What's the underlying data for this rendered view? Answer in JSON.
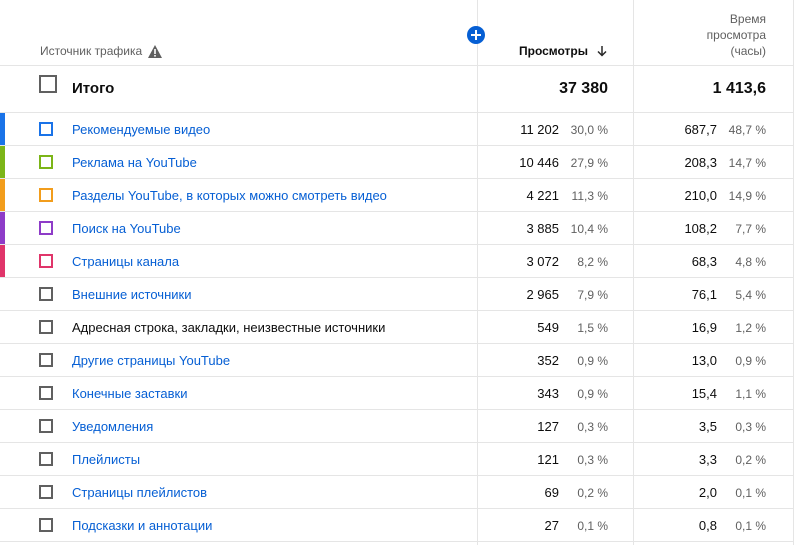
{
  "header": {
    "source_label": "Источник трафика",
    "views_label": "Просмотры",
    "watch_time_label_lines": [
      "Время",
      "просмотра",
      "(часы)"
    ]
  },
  "total": {
    "label": "Итого",
    "views": "37 380",
    "watch_time": "1 413,6"
  },
  "rows": [
    {
      "label": "Рекомендуемые видео",
      "views": "11 202",
      "views_pct": "30,0 %",
      "watch": "687,7",
      "watch_pct": "48,7 %",
      "color": "#1a73e8",
      "link": true
    },
    {
      "label": "Реклама на YouTube",
      "views": "10 446",
      "views_pct": "27,9 %",
      "watch": "208,3",
      "watch_pct": "14,7 %",
      "color": "#7cb518",
      "link": true
    },
    {
      "label": "Разделы YouTube, в которых можно смотреть видео",
      "views": "4 221",
      "views_pct": "11,3 %",
      "watch": "210,0",
      "watch_pct": "14,9 %",
      "color": "#f29d1c",
      "link": true
    },
    {
      "label": "Поиск на YouTube",
      "views": "3 885",
      "views_pct": "10,4 %",
      "watch": "108,2",
      "watch_pct": "7,7 %",
      "color": "#8e3cc8",
      "link": true
    },
    {
      "label": "Страницы канала",
      "views": "3 072",
      "views_pct": "8,2 %",
      "watch": "68,3",
      "watch_pct": "4,8 %",
      "color": "#e0356a",
      "link": true
    },
    {
      "label": "Внешние источники",
      "views": "2 965",
      "views_pct": "7,9 %",
      "watch": "76,1",
      "watch_pct": "5,4 %",
      "color": "",
      "link": true
    },
    {
      "label": "Адресная строка, закладки, неизвестные источники",
      "views": "549",
      "views_pct": "1,5 %",
      "watch": "16,9",
      "watch_pct": "1,2 %",
      "color": "",
      "link": false
    },
    {
      "label": "Другие страницы YouTube",
      "views": "352",
      "views_pct": "0,9 %",
      "watch": "13,0",
      "watch_pct": "0,9 %",
      "color": "",
      "link": true
    },
    {
      "label": "Конечные заставки",
      "views": "343",
      "views_pct": "0,9 %",
      "watch": "15,4",
      "watch_pct": "1,1 %",
      "color": "",
      "link": true
    },
    {
      "label": "Уведомления",
      "views": "127",
      "views_pct": "0,3 %",
      "watch": "3,5",
      "watch_pct": "0,3 %",
      "color": "",
      "link": true
    },
    {
      "label": "Плейлисты",
      "views": "121",
      "views_pct": "0,3 %",
      "watch": "3,3",
      "watch_pct": "0,2 %",
      "color": "",
      "link": true
    },
    {
      "label": "Страницы плейлистов",
      "views": "69",
      "views_pct": "0,2 %",
      "watch": "2,0",
      "watch_pct": "0,1 %",
      "color": "",
      "link": true
    },
    {
      "label": "Подсказки и аннотации",
      "views": "27",
      "views_pct": "0,1 %",
      "watch": "0,8",
      "watch_pct": "0,1 %",
      "color": "",
      "link": true
    }
  ],
  "icons": {
    "warning": "warning-icon",
    "add": "add-metric-icon",
    "sort": "arrow-down-icon"
  }
}
